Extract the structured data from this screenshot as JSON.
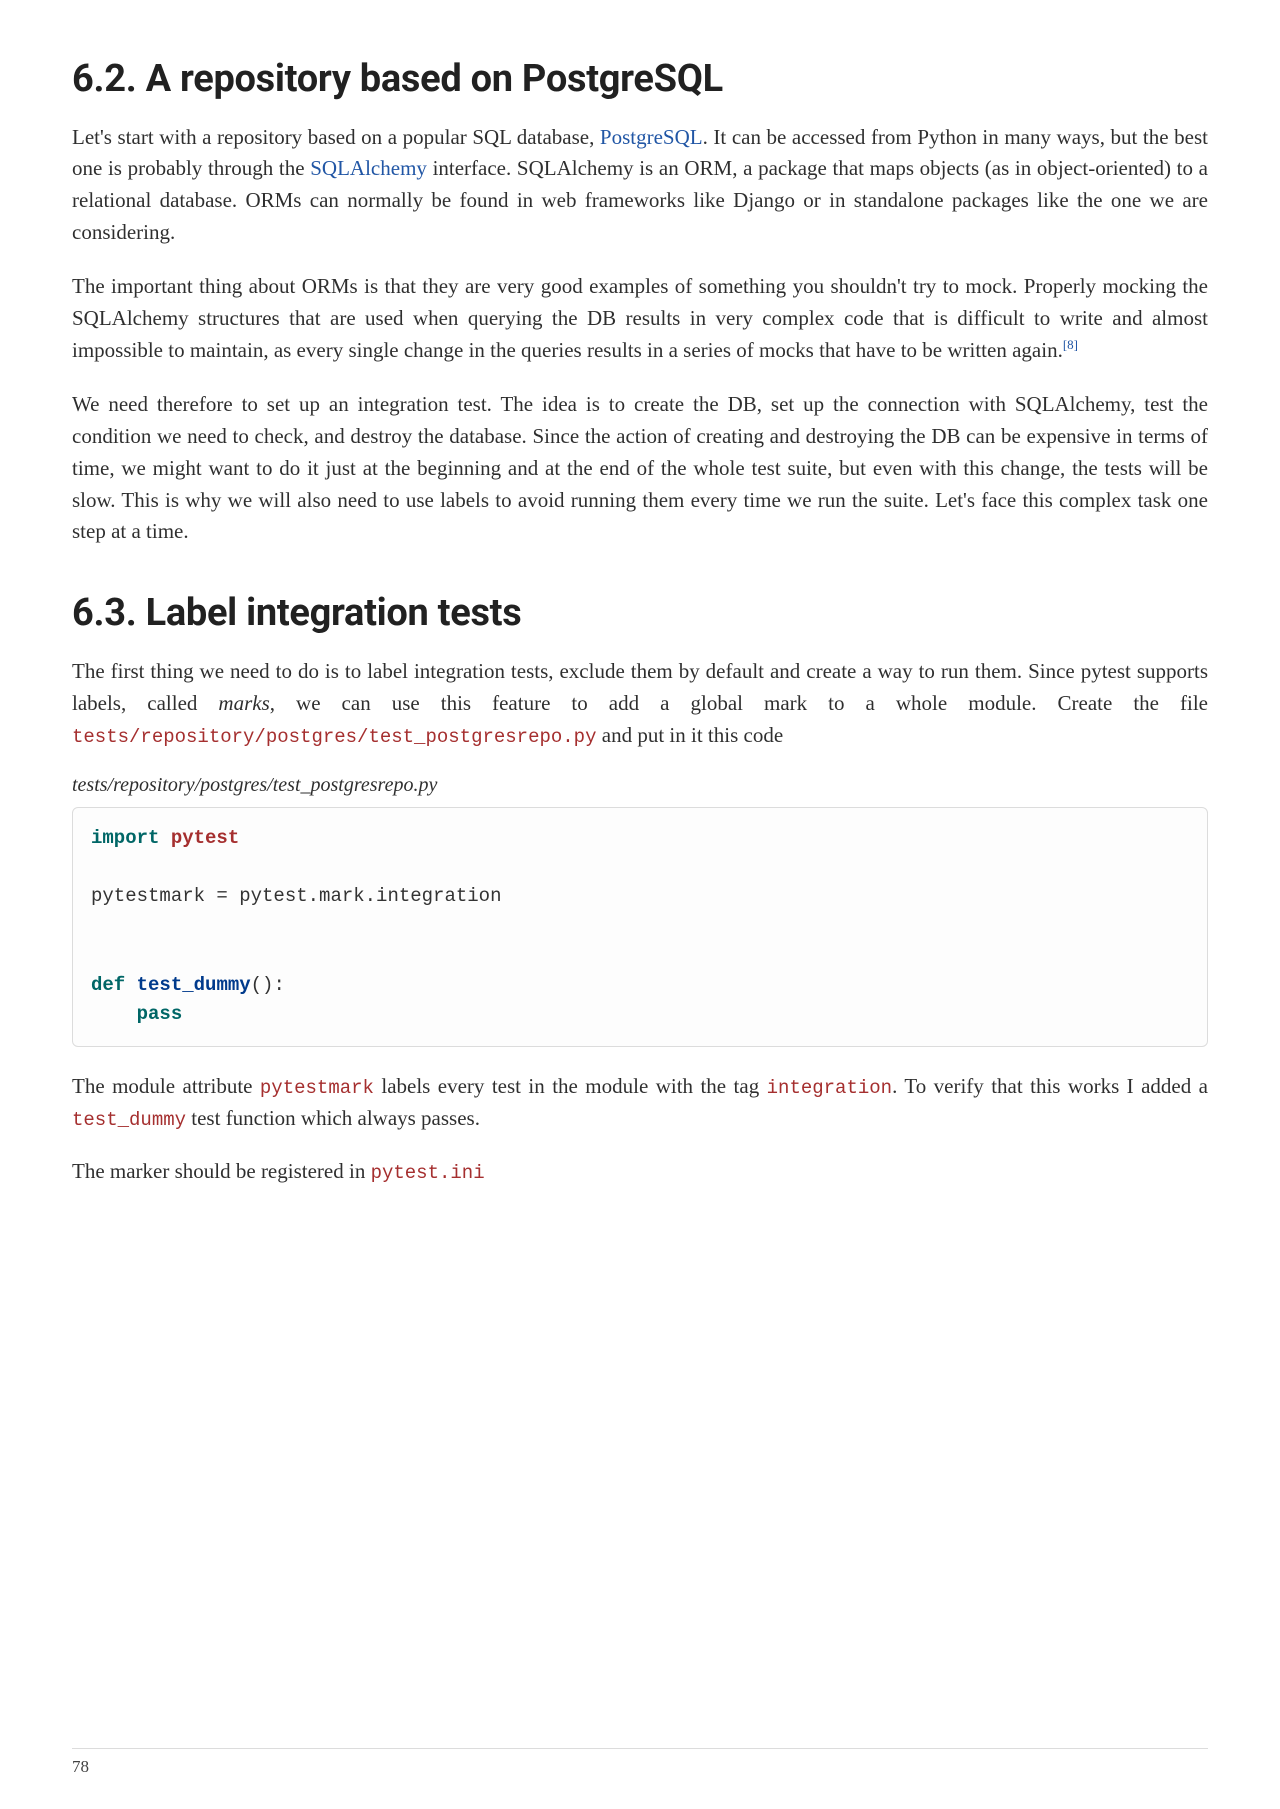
{
  "section62": {
    "title": "6.2. A repository based on PostgreSQL",
    "p1_a": "Let's start with a repository based on a popular SQL database, ",
    "link_pg": "PostgreSQL",
    "p1_b": ". It can be accessed from Python in many ways, but the best one is probably through the ",
    "link_sa": "SQLAlchemy",
    "p1_c": " interface. SQLAlchemy is an ORM, a package that maps objects (as in object-oriented) to a relational database. ORMs can normally be found in web frameworks like Django or in standalone packages like the one we are considering.",
    "p2_a": "The important thing about ORMs is that they are very good examples of something you shouldn't try to mock. Properly mocking the SQLAlchemy structures that are used when querying the DB results in very complex code that is difficult to write and almost impossible to maintain, as every single change in the queries results in a series of mocks that have to be written again.",
    "footnote": "[8]",
    "p3": "We need therefore to set up an integration test. The idea is to create the DB, set up the connection with SQLAlchemy, test the condition we need to check, and destroy the database. Since the action of creating and destroying the DB can be expensive in terms of time, we might want to do it just at the beginning and at the end of the whole test suite, but even with this change, the tests will be slow. This is why we will also need to use labels to avoid running them every time we run the suite. Let's face this complex task one step at a time."
  },
  "section63": {
    "title": "6.3. Label integration tests",
    "p1_a": "The first thing we need to do is to label integration tests, exclude them by default and create a way to run them. Since pytest supports labels, called ",
    "p1_em": "marks",
    "p1_b": ", we can use this feature to add a global mark to a whole module. Create the file ",
    "p1_code": "tests/repository/postgres/test_postgresrepo.py",
    "p1_c": " and put in it this code",
    "caption": "tests/repository/postgres/test_postgresrepo.py",
    "code_tokens": {
      "kw_import": "import",
      "nn_pytest": "pytest",
      "line2": "pytestmark = pytest.mark.integration",
      "kw_def": "def",
      "fn_name": "test_dummy",
      "parens": "():",
      "kw_pass": "pass"
    },
    "p2_a": "The module attribute ",
    "p2_code1": "pytestmark",
    "p2_b": " labels every test in the module with the tag ",
    "p2_code2": "integration",
    "p2_c": ". To verify that this works I added a ",
    "p2_code3": "test_dummy",
    "p2_d": " test function which always passes.",
    "p3_a": "The marker should be registered in ",
    "p3_code": "pytest.ini"
  },
  "page_number": "78"
}
